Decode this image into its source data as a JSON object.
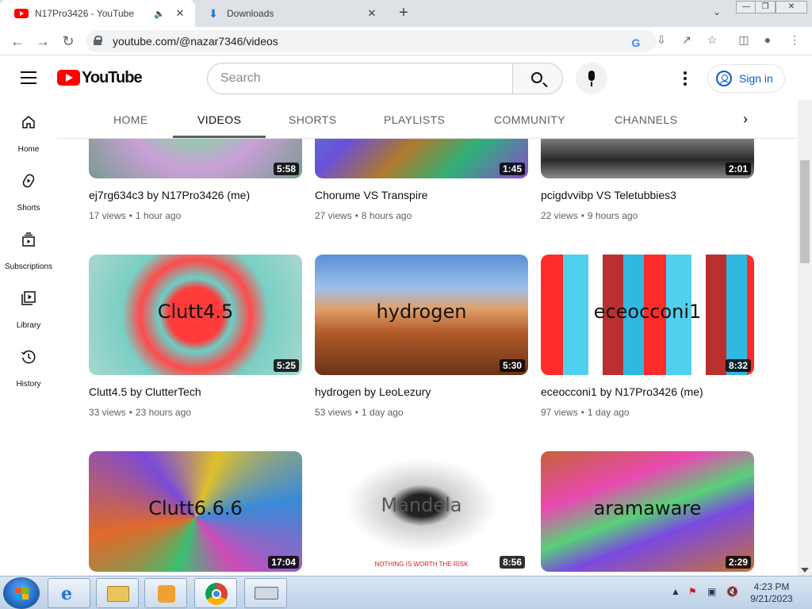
{
  "browser": {
    "tabs": [
      {
        "title": "N17Pro3426 - YouTube",
        "active": true
      },
      {
        "title": "Downloads",
        "active": false
      }
    ],
    "url": "youtube.com/@nazar7346/videos"
  },
  "yt": {
    "logo_text": "YouTube",
    "search_placeholder": "Search",
    "sign_in": "Sign in",
    "guide": [
      {
        "label": "Home",
        "icon": "home-icon"
      },
      {
        "label": "Shorts",
        "icon": "shorts-icon"
      },
      {
        "label": "Subscriptions",
        "icon": "subscriptions-icon"
      },
      {
        "label": "Library",
        "icon": "library-icon"
      },
      {
        "label": "History",
        "icon": "history-icon"
      }
    ],
    "channel_tabs": [
      "HOME",
      "VIDEOS",
      "SHORTS",
      "PLAYLISTS",
      "COMMUNITY",
      "CHANNELS"
    ],
    "active_tab": "VIDEOS",
    "videos": [
      {
        "title": "ej7rg634c3 by N17Pro3426 (me)",
        "views": "17 views",
        "age": "1 hour ago",
        "duration": "5:58",
        "thumb_text": ""
      },
      {
        "title": "Chorume VS Transpire",
        "views": "27 views",
        "age": "8 hours ago",
        "duration": "1:45",
        "thumb_text": ""
      },
      {
        "title": "pcigdvvibp VS Teletubbies3",
        "views": "22 views",
        "age": "9 hours ago",
        "duration": "2:01",
        "thumb_text": ""
      },
      {
        "title": "Clutt4.5 by ClutterTech",
        "views": "33 views",
        "age": "23 hours ago",
        "duration": "5:25",
        "thumb_text": "Clutt4.5"
      },
      {
        "title": "hydrogen by LeoLezury",
        "views": "53 views",
        "age": "1 day ago",
        "duration": "5:30",
        "thumb_text": "hydrogen"
      },
      {
        "title": "eceocconi1 by N17Pro3426 (me)",
        "views": "97 views",
        "age": "1 day ago",
        "duration": "8:32",
        "thumb_text": "eceocconi1"
      },
      {
        "title": "",
        "views": "",
        "age": "",
        "duration": "17:04",
        "thumb_text": "Clutt6.6.6"
      },
      {
        "title": "",
        "views": "",
        "age": "",
        "duration": "8:56",
        "thumb_text": "Mandela",
        "thumb_subtext": "NOTHING IS WORTH THE RISK"
      },
      {
        "title": "",
        "views": "",
        "age": "",
        "duration": "2:29",
        "thumb_text": "aramaware"
      }
    ]
  },
  "taskbar": {
    "time": "4:23 PM",
    "date": "9/21/2023"
  }
}
